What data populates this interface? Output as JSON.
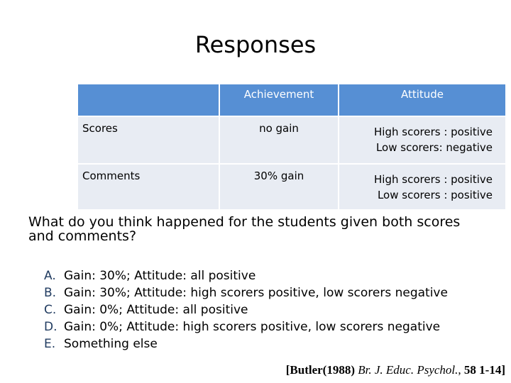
{
  "title": "Responses",
  "table": {
    "headers": [
      "",
      "Achievement",
      "Attitude"
    ],
    "rows": [
      {
        "label": "Scores",
        "achievement": "no gain",
        "attitude": [
          "High scorers : positive",
          "Low scorers: negative"
        ]
      },
      {
        "label": "Comments",
        "achievement": "30% gain",
        "attitude": [
          "High scorers : positive",
          "Low scorers : positive"
        ]
      }
    ],
    "colors": {
      "header_bg": "#568fd4",
      "cell_bg": "#e8ecf3",
      "header_text": "#ffffff"
    }
  },
  "question": "What do you think happened for the students given both scores and comments?",
  "options": [
    {
      "letter": "A.",
      "text": "Gain: 30%; Attitude: all positive"
    },
    {
      "letter": "B.",
      "text": "Gain: 30%; Attitude: high scorers positive, low scorers negative"
    },
    {
      "letter": "C.",
      "text": "Gain: 0%; Attitude: all positive"
    },
    {
      "letter": "D.",
      "text": "Gain: 0%; Attitude: high scorers positive, low scorers negative"
    },
    {
      "letter": "E.",
      "text": "Something else"
    }
  ],
  "citation": {
    "open": "[",
    "author": "Butler(1988)",
    "journal": "Br. J. Educ. Psychol.",
    "comma": ",",
    "volume": "58",
    "pages": "1-14",
    "close": "]"
  }
}
